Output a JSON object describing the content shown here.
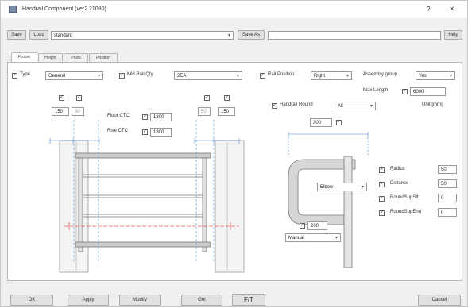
{
  "window": {
    "title": "Handrail Component (ver2.21080)",
    "help": "?",
    "close": "×"
  },
  "toolbar": {
    "save": "Save",
    "load": "Load",
    "preset": "standard",
    "save_as": "Save As",
    "help": "Help"
  },
  "tabs": [
    "Fixture",
    "Height",
    "Posts",
    "Position"
  ],
  "row1": {
    "type_label": "Type",
    "type_value": "General",
    "mid_rail_label": "Mid Rail Qty",
    "mid_rail_value": "2EA",
    "rail_position_label": "Rail Position",
    "rail_position_value": "Right",
    "assembly_label": "Assembly group",
    "assembly_value": "Yes"
  },
  "max_length": {
    "label": "Max Length",
    "value": "6000"
  },
  "handrail_round": {
    "label": "Handrail Round",
    "value": "All"
  },
  "unit": "Unit [mm]",
  "left_dims": {
    "d1": "150",
    "d2": "50"
  },
  "right_dims": {
    "d1": "50",
    "d2": "150"
  },
  "ctc": {
    "floor_label": "Floor CTC",
    "floor_value": "1800",
    "rise_label": "Rise CTC",
    "rise_value": "1800"
  },
  "detail": {
    "top_value": "300",
    "elbow": "Elbow",
    "bottom_value": "200",
    "manual": "Manual"
  },
  "params": [
    {
      "label": "Radius",
      "value": "50"
    },
    {
      "label": "Distance",
      "value": "50"
    },
    {
      "label": "RoundSupStt",
      "value": "0"
    },
    {
      "label": "RoundSupEnd",
      "value": "0"
    }
  ],
  "footer": {
    "ok": "OK",
    "apply": "Apply",
    "modify": "Modify",
    "get": "Get",
    "toggle": "F/T",
    "cancel": "Cancel"
  }
}
